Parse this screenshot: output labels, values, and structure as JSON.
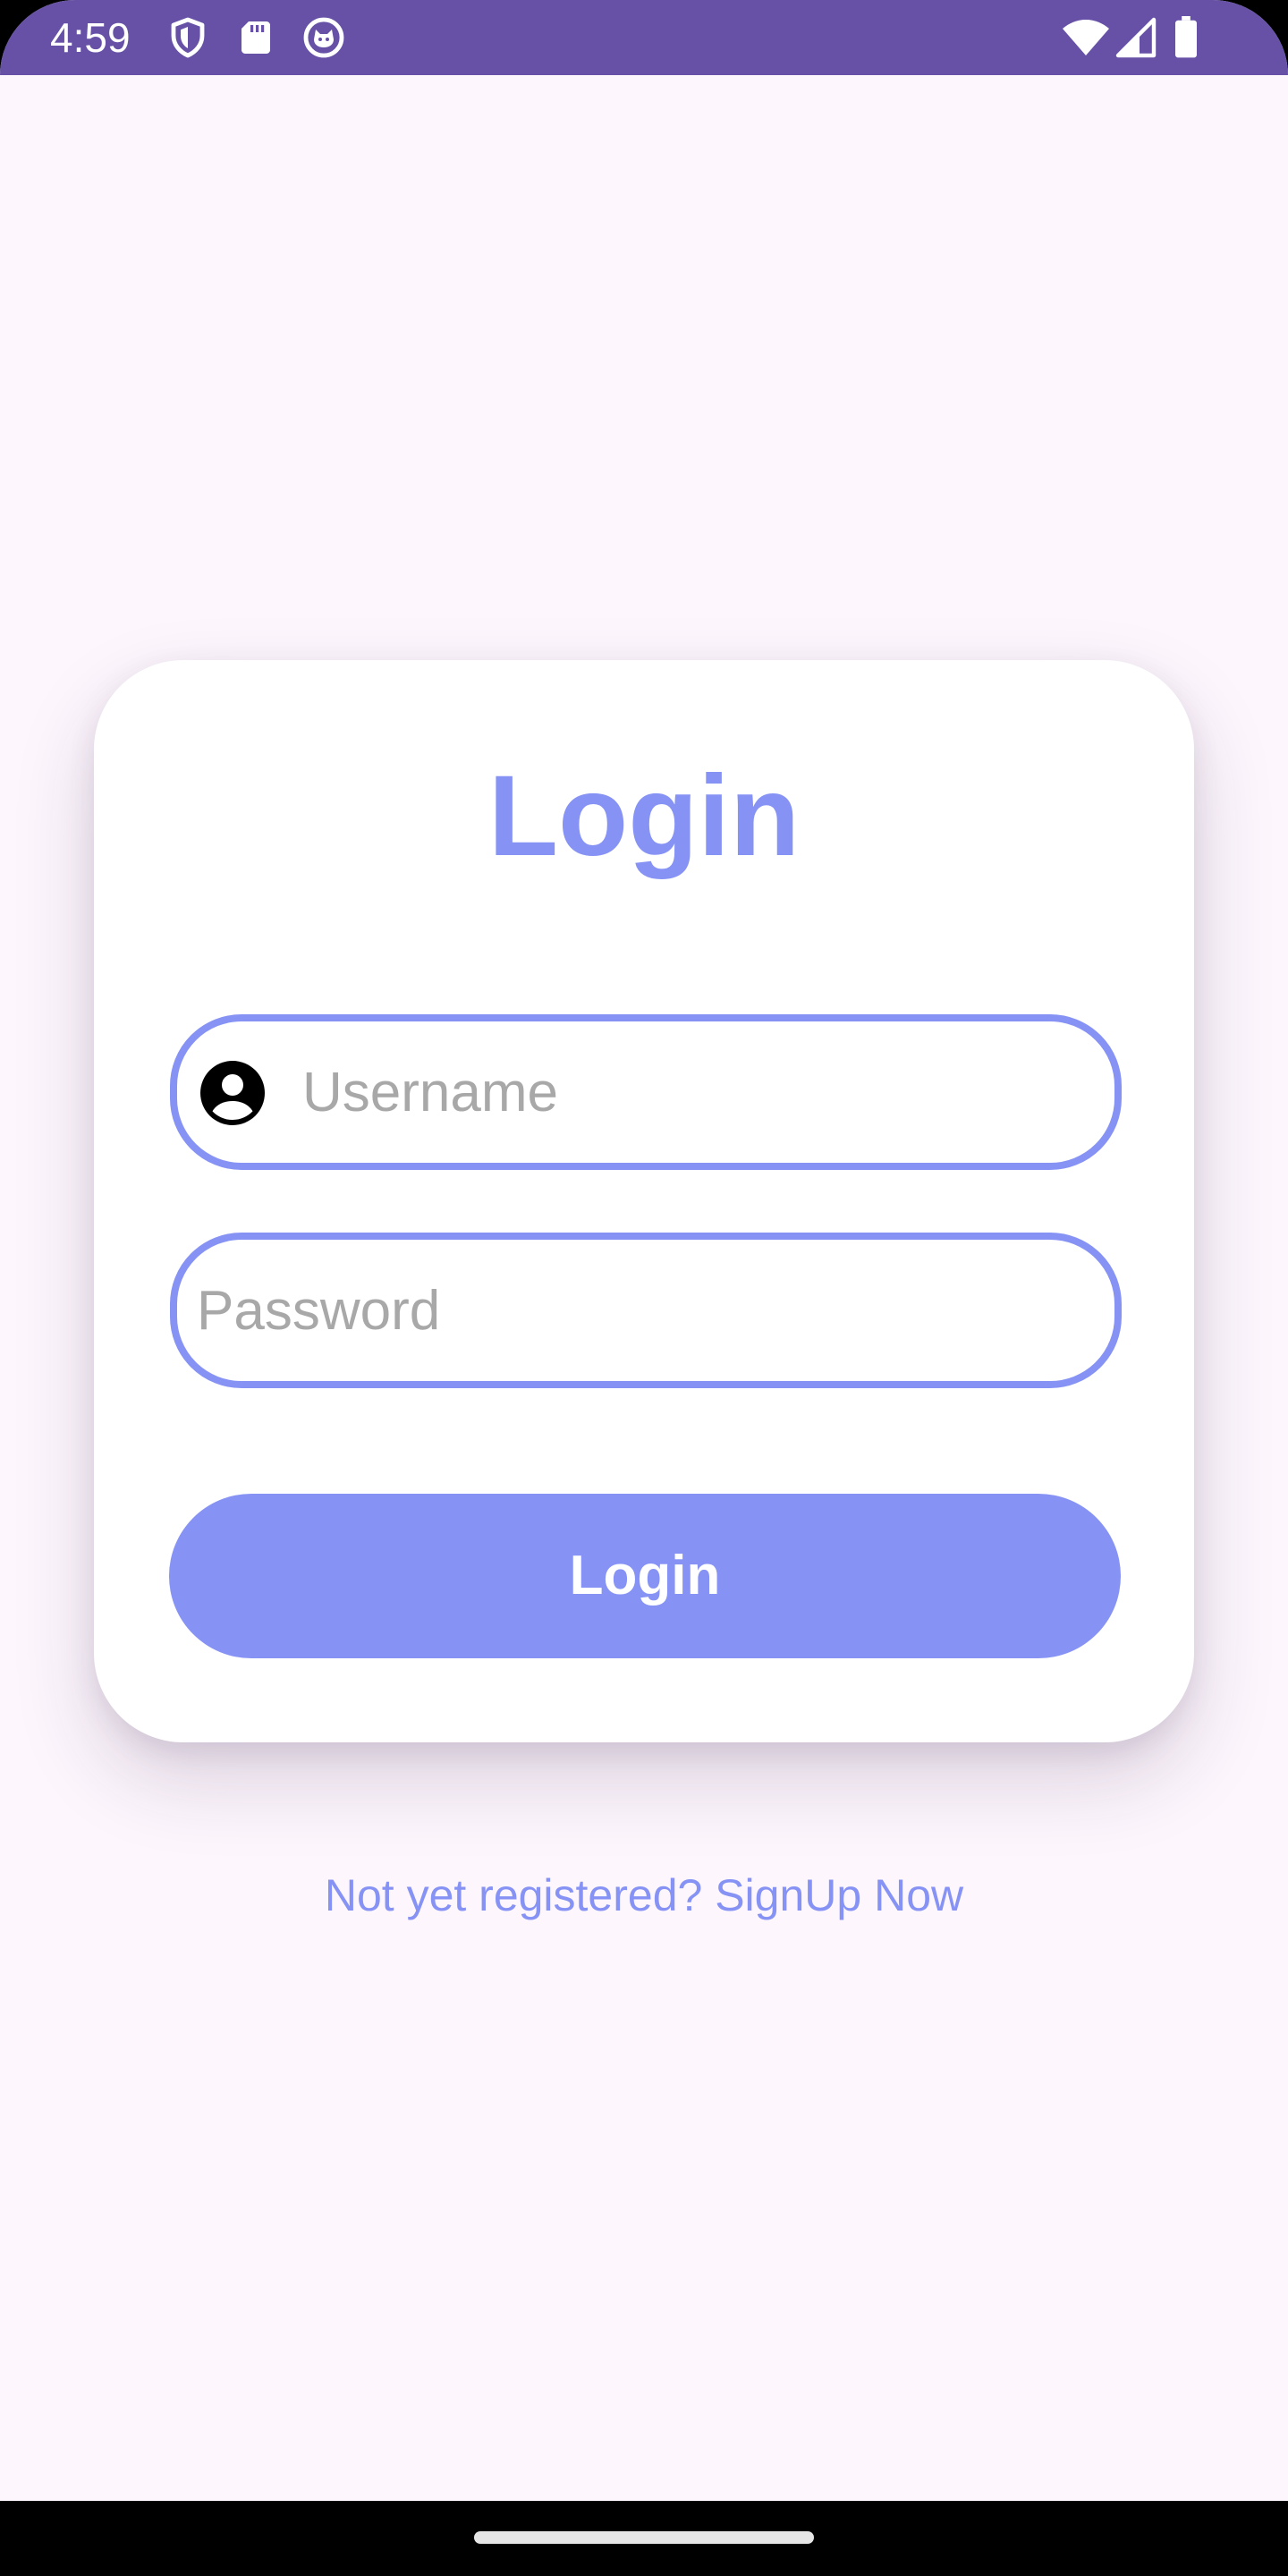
{
  "status_bar": {
    "time": "4:59",
    "background_color": "#6651A6",
    "icons_left": [
      "shield-icon",
      "sd-card-icon",
      "cat-face-icon"
    ],
    "icons_right": [
      "wifi-icon",
      "cell-signal-icon",
      "battery-icon"
    ]
  },
  "card": {
    "title": "Login",
    "username": {
      "placeholder": "Username",
      "value": "",
      "icon": "account-circle-icon"
    },
    "password": {
      "placeholder": "Password",
      "value": ""
    },
    "login_button_label": "Login"
  },
  "signup_link": "Not yet registered? SignUp Now",
  "colors": {
    "accent": "#8693F5",
    "background": "#FDF6FD",
    "card": "#FFFFFF",
    "placeholder": "#A8A8A8"
  }
}
